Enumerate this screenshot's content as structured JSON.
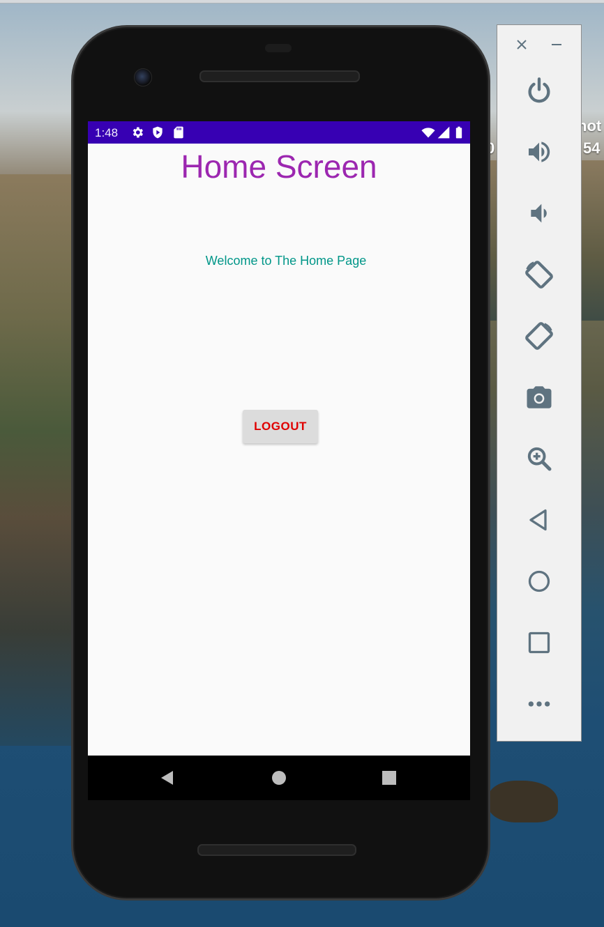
{
  "desktop": {
    "partial_text_top": "hot",
    "partial_text_mid": "54",
    "partial_text_left": "0"
  },
  "phone": {
    "status_bar": {
      "time": "1:48",
      "icons": [
        "settings-icon",
        "play-protect-icon",
        "sd-card-icon",
        "wifi-icon",
        "cell-signal-icon",
        "battery-icon"
      ]
    },
    "app": {
      "title": "Home Screen",
      "welcome_text": "Welcome to The Home Page",
      "logout_label": "LOGOUT",
      "colors": {
        "title": "#9c27b0",
        "welcome": "#009688",
        "logout_text": "#e00000",
        "status_bar": "#3700b3"
      }
    },
    "nav_bar": {
      "buttons": [
        "back-icon",
        "home-icon",
        "overview-icon"
      ]
    }
  },
  "emulator_toolbar": {
    "window_controls": [
      "close-icon",
      "minimize-icon"
    ],
    "buttons": [
      "power-icon",
      "volume-up-icon",
      "volume-down-icon",
      "rotate-left-icon",
      "rotate-right-icon",
      "camera-icon",
      "zoom-icon",
      "back-icon",
      "home-icon",
      "overview-icon",
      "more-icon"
    ],
    "icon_color": "#5f7380"
  }
}
